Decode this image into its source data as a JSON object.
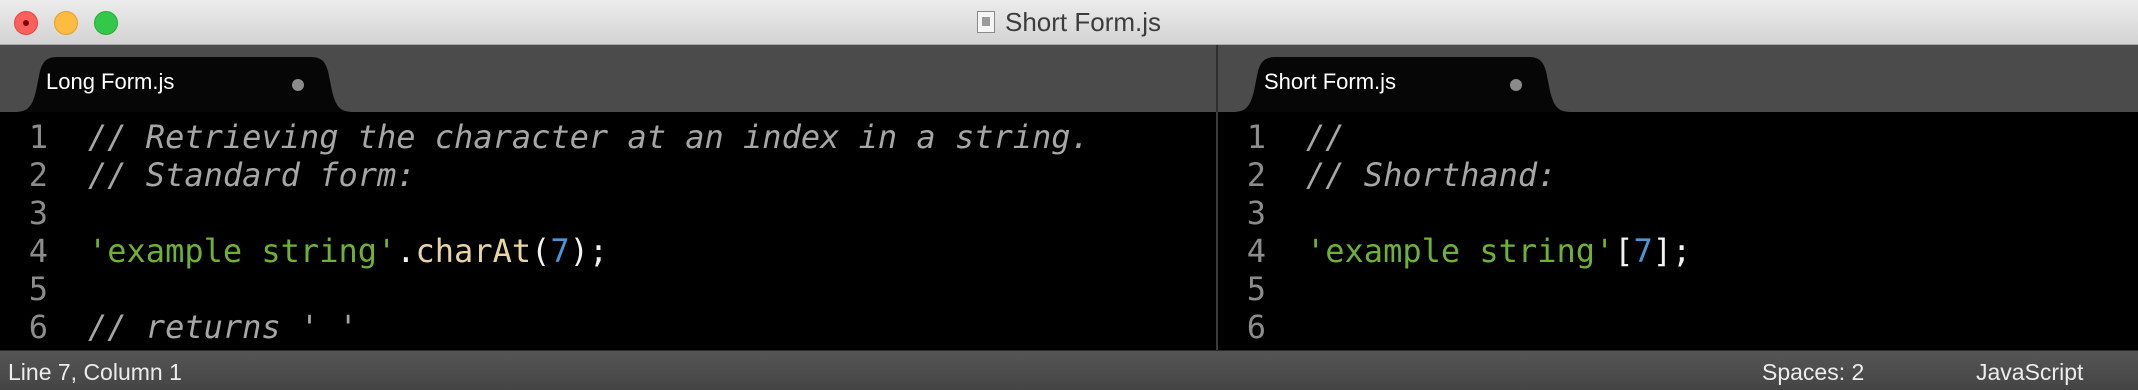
{
  "window": {
    "title": "Short Form.js",
    "controls": {
      "close_color": "#fc605c",
      "minimize_color": "#fdbc40",
      "maximize_color": "#34c84a"
    }
  },
  "tabs": [
    {
      "label": "Long Form.js",
      "active": true
    },
    {
      "label": "Short Form.js",
      "active": true
    }
  ],
  "left_pane": {
    "lines": [
      {
        "number": "1",
        "tokens": [
          {
            "type": "comment",
            "text": "// Retrieving the character at an index in a string."
          }
        ]
      },
      {
        "number": "2",
        "tokens": [
          {
            "type": "comment",
            "text": "// Standard form:"
          }
        ]
      },
      {
        "number": "3",
        "tokens": []
      },
      {
        "number": "4",
        "tokens": [
          {
            "type": "string",
            "text": "'example string'"
          },
          {
            "type": "punc",
            "text": "."
          },
          {
            "type": "method",
            "text": "charAt"
          },
          {
            "type": "punc",
            "text": "("
          },
          {
            "type": "num",
            "text": "7"
          },
          {
            "type": "punc",
            "text": ");"
          }
        ]
      },
      {
        "number": "5",
        "tokens": []
      },
      {
        "number": "6",
        "tokens": [
          {
            "type": "comment",
            "text": "// returns ' '"
          }
        ]
      }
    ]
  },
  "right_pane": {
    "lines": [
      {
        "number": "1",
        "tokens": [
          {
            "type": "comment",
            "text": "//"
          }
        ]
      },
      {
        "number": "2",
        "tokens": [
          {
            "type": "comment",
            "text": "// Shorthand:"
          }
        ]
      },
      {
        "number": "3",
        "tokens": []
      },
      {
        "number": "4",
        "tokens": [
          {
            "type": "string",
            "text": "'example string'"
          },
          {
            "type": "punc",
            "text": "["
          },
          {
            "type": "num",
            "text": "7"
          },
          {
            "type": "punc",
            "text": "];"
          }
        ]
      },
      {
        "number": "5",
        "tokens": []
      },
      {
        "number": "6",
        "tokens": []
      }
    ]
  },
  "status_bar": {
    "position": "Line 7, Column 1",
    "indentation": "Spaces: 2",
    "syntax": "JavaScript"
  },
  "theme": {
    "comment": "#a6a6a6",
    "string": "#6fb233",
    "method": "#e8d5a3",
    "number": "#4a97d8",
    "background": "#000000"
  }
}
